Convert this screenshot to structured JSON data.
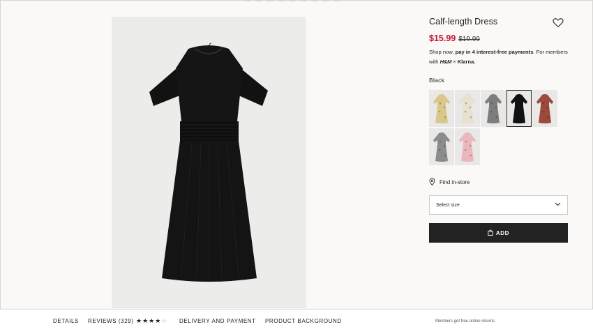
{
  "product": {
    "title": "Calf-length Dress",
    "price_now": "$15.99",
    "price_old": "$19.99",
    "klarna_prefix": "Shop now, ",
    "klarna_bold": "pay in 4 interest-free payments",
    "klarna_suffix": ". For members with ",
    "klarna_hm": "H&M",
    "klarna_x": " × ",
    "klarna_brand": "Klarna."
  },
  "colors": {
    "selected_name": "Black",
    "swatch_names": [
      "yellow-floral",
      "cream-black-floral",
      "grey-pattern",
      "black",
      "rust-floral",
      "grey-floral",
      "light-pink"
    ],
    "swatch_colors": [
      "#d9c88a",
      "#e8e1cf",
      "#7d7d7d",
      "#111111",
      "#9b4b3b",
      "#8c8c8c",
      "#eab7bd"
    ],
    "selected_index": 3
  },
  "store": {
    "find_label": "Find in-store"
  },
  "size_select": {
    "value": "Select size"
  },
  "cart": {
    "add_label": "ADD"
  },
  "bottom_tabs": {
    "details": "DETAILS",
    "reviews": "REVIEWS (329)",
    "rating": 4,
    "rating_max": 5,
    "delivery": "DELIVERY AND PAYMENT",
    "background": "PRODUCT BACKGROUND",
    "members_note": "Members get free online returns."
  },
  "icons": {
    "favorite": "heart-icon",
    "store": "location-pin-icon",
    "dropdown": "chevron-down-icon",
    "bag": "shopping-bag-icon"
  },
  "theme": {
    "sale_red": "#c4122f",
    "button_black": "#222222",
    "page_bg": "#faf9f8"
  }
}
